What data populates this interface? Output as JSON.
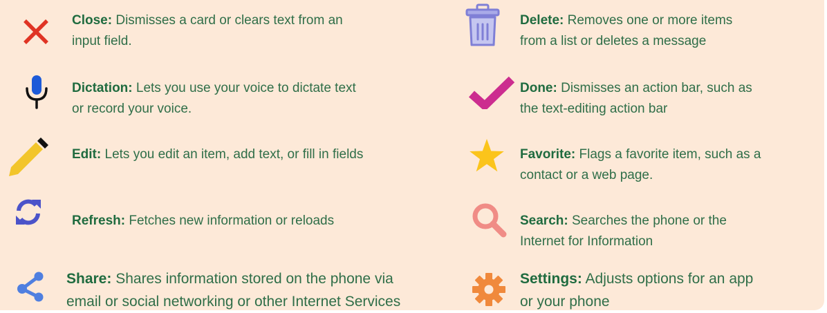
{
  "colors": {
    "background": "#fde9d8",
    "term_text": "#1f6b3f",
    "desc_text": "#2f6e48",
    "close_icon": "#e03424",
    "delete_icon": "#7f7fd6",
    "dictation_icon": "#1c5ad8",
    "done_icon": "#cc2d8f",
    "edit_icon": "#f2c52b",
    "favorite_icon": "#fbc41b",
    "refresh_icon": "#4b53c9",
    "search_icon": "#f08c86",
    "share_icon": "#4f7fe0",
    "settings_icon": "#f0893c"
  },
  "items": {
    "close": {
      "icon": "close-icon",
      "term": "Close:",
      "line1": "Dismisses a card or clears text from an",
      "line2": "input field."
    },
    "delete": {
      "icon": "trash-icon",
      "term": "Delete:",
      "line1": "Removes one or more items",
      "line2": "from a list or deletes a message"
    },
    "dictation": {
      "icon": "microphone-icon",
      "term": "Dictation:",
      "line1": "Lets you use your voice to dictate text",
      "line2": "or record your voice."
    },
    "done": {
      "icon": "checkmark-icon",
      "term": "Done:",
      "line1": "Dismisses an action bar, such as",
      "line2": "the text-editing action bar"
    },
    "edit": {
      "icon": "pencil-icon",
      "term": "Edit:",
      "line1": "Lets you edit an item, add text, or fill in fields"
    },
    "favorite": {
      "icon": "star-icon",
      "term": "Favorite:",
      "line1": "Flags a favorite item, such as a",
      "line2": "contact or a web page."
    },
    "refresh": {
      "icon": "refresh-icon",
      "term": "Refresh:",
      "line1": "Fetches new information or reloads"
    },
    "search": {
      "icon": "magnifier-icon",
      "term": "Search:",
      "line1": "Searches the phone or the",
      "line2": "Internet for Information"
    },
    "share": {
      "icon": "share-icon",
      "term": "Share:",
      "line1": "Shares information stored on the phone via",
      "line2": "email or social networking or other Internet Services"
    },
    "settings": {
      "icon": "gear-icon",
      "term": "Settings:",
      "line1": "Adjusts options for an app",
      "line2": "or your phone"
    }
  }
}
